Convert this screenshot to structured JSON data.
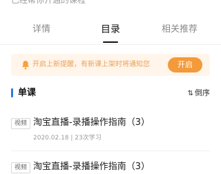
{
  "header": {
    "partial_text": "已经帮你开通的课程"
  },
  "tabs": [
    {
      "label": "详情",
      "active": false
    },
    {
      "label": "目录",
      "active": true
    },
    {
      "label": "相关推荐",
      "active": false
    }
  ],
  "notice": {
    "text": "开启上新提醒，有新课上架时将通知您",
    "button_label": "开启",
    "icon": "bell-icon",
    "colors": {
      "text": "#e9a25a",
      "button": "#f39a3a",
      "background": "#fff5ea"
    }
  },
  "section": {
    "title": "单课",
    "sort_label": "倒序",
    "accent": "#2c7be5"
  },
  "items": [
    {
      "tag": "视频",
      "title": "淘宝直播-录播操作指南（3）",
      "meta": "2020.02.18 | 23次学习"
    },
    {
      "tag": "视频",
      "title": "淘宝直播-录播操作指南（3）",
      "meta": ""
    }
  ]
}
